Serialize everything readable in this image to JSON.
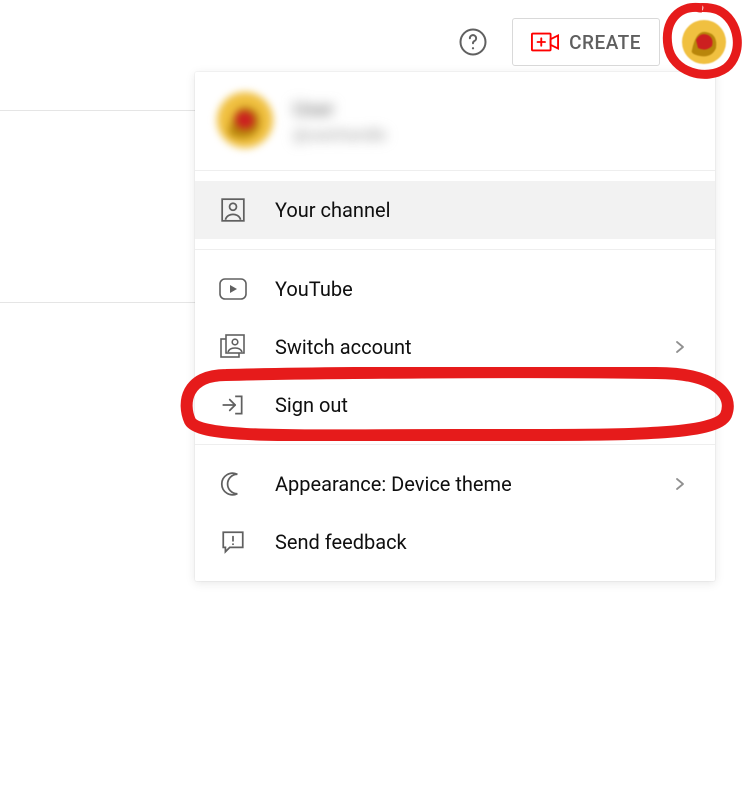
{
  "topbar": {
    "create_label": "CREATE"
  },
  "user": {
    "name": "User",
    "handle": "@userhandle"
  },
  "menu": {
    "your_channel": "Your channel",
    "youtube": "YouTube",
    "switch_account": "Switch account",
    "sign_out": "Sign out",
    "appearance": "Appearance: Device theme",
    "send_feedback": "Send feedback"
  }
}
